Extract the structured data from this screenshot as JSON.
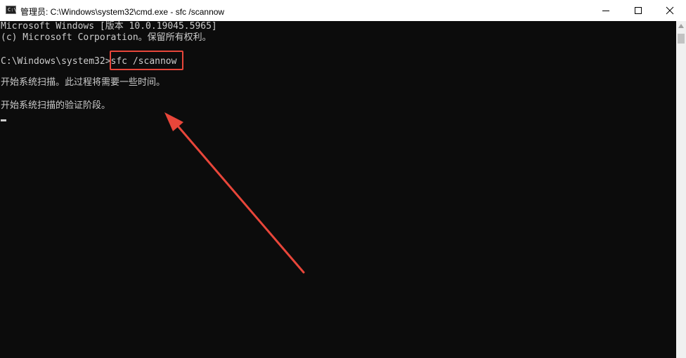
{
  "window": {
    "icon_text": "C:\\",
    "title": "管理员: C:\\Windows\\system32\\cmd.exe - sfc  /scannow"
  },
  "controls": {
    "minimize_icon": "minimize-icon",
    "maximize_icon": "maximize-icon",
    "close_icon": "close-icon"
  },
  "terminal": {
    "lines": [
      "Microsoft Windows [版本 10.0.19045.5965]",
      "(c) Microsoft Corporation。保留所有权利。",
      "",
      "C:\\Windows\\system32>sfc /scannow",
      "",
      "开始系统扫描。此过程将需要一些时间。",
      "",
      "开始系统扫描的验证阶段。"
    ]
  },
  "annotation": {
    "color": "#e8463a"
  },
  "colors": {
    "terminal_background": "#0c0c0c",
    "terminal_text": "#cccccc",
    "titlebar_background": "#ffffff"
  }
}
